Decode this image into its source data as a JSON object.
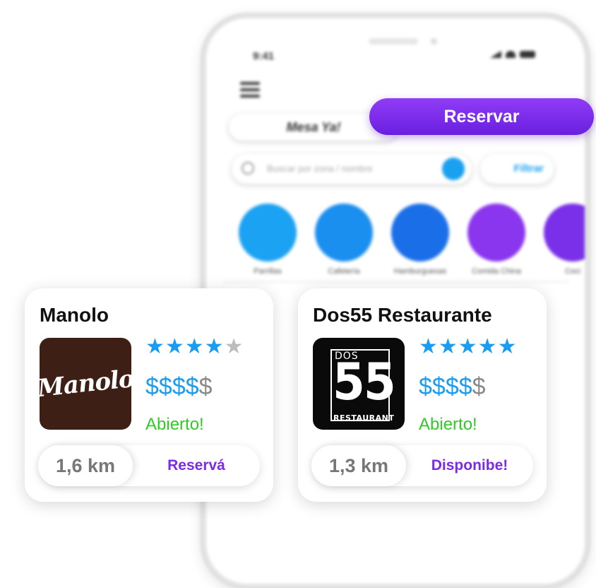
{
  "phone": {
    "time": "9:41",
    "tab_left": "Mesa Ya!",
    "search_placeholder": "Buscar por zona / nombre",
    "filter_label": "Filtrar",
    "categories": [
      {
        "label": "Parrillas",
        "icon": "steak-icon",
        "color": "#1ba2f2"
      },
      {
        "label": "Cafetería",
        "icon": "coffee-cup-icon",
        "color": "#1a8fef"
      },
      {
        "label": "Hamburguesas",
        "icon": "burger-icon",
        "color": "#1a6fe8"
      },
      {
        "label": "Comida China",
        "icon": "rice-bowl-icon",
        "color": "#8a35ee"
      },
      {
        "label": "Coci",
        "icon": "category-icon",
        "color": "#7a30e8"
      }
    ]
  },
  "reservar_button": "Reservar",
  "cards": [
    {
      "name": "Manolo",
      "logo_text": "Manolo",
      "stars_filled": 4,
      "stars_total": 5,
      "price_level": 4,
      "price_total": 5,
      "stars_on": "★★★★",
      "stars_off": "★",
      "price_on": "$$$$",
      "price_off": "$",
      "status": "Abierto!",
      "distance": "1,6 km",
      "action": "Reservá"
    },
    {
      "name": "Dos55 Restaurante",
      "logo_dos": "DOS",
      "logo_num": "55",
      "logo_rest": "RESTAURANT",
      "stars_filled": 5,
      "stars_total": 5,
      "price_level": 4,
      "price_total": 5,
      "stars_on": "★★★★★",
      "stars_off": "",
      "price_on": "$$$$",
      "price_off": "$",
      "status": "Abierto!",
      "distance": "1,3 km",
      "action": "Disponibe!"
    }
  ],
  "colors": {
    "accent_purple": "#7b2ae8",
    "accent_blue": "#1a9cf0",
    "open_green": "#2ecc22"
  }
}
